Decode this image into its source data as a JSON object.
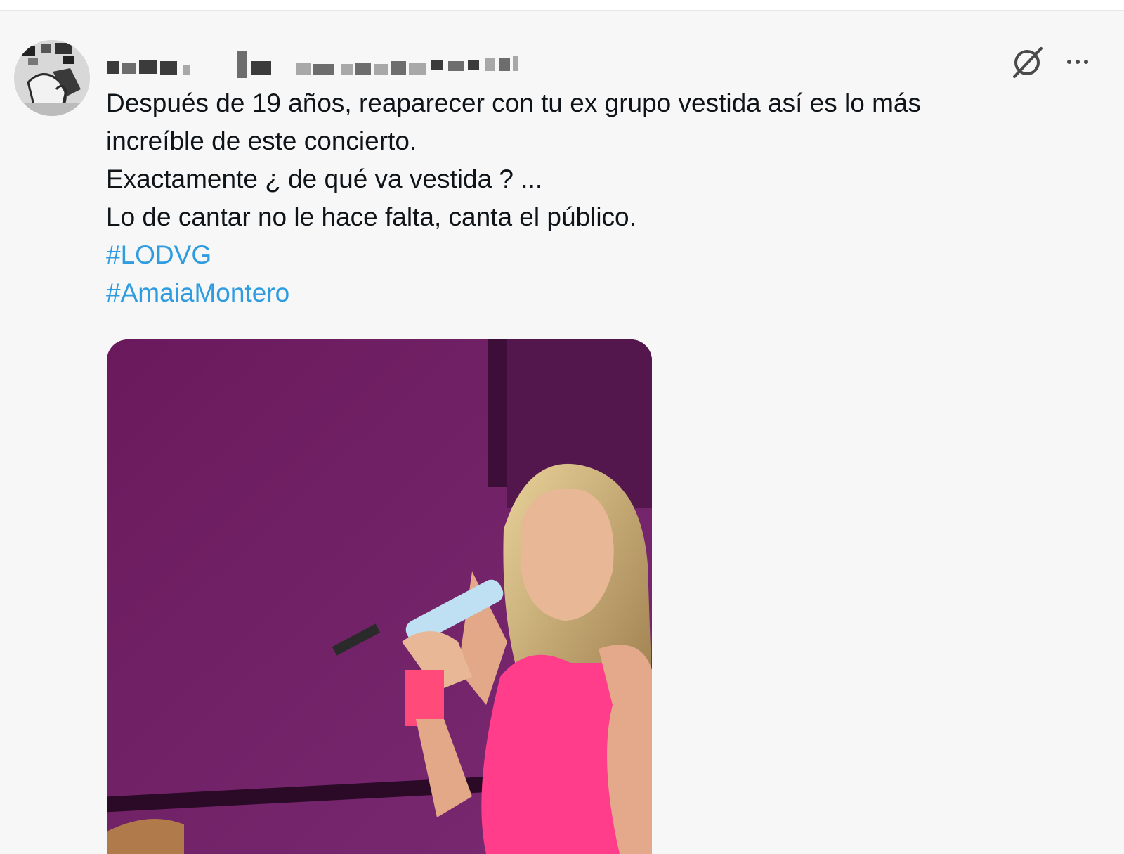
{
  "tweet": {
    "author_name": "",
    "lines": [
      "Después de 19 años, reaparecer con tu ex grupo vestida así es lo más",
      "increíble de este concierto.",
      "Exactamente ¿ de qué va vestida ? ...",
      "Lo de cantar no le hace falta, canta el público."
    ],
    "hashtags": [
      "#LODVG",
      "#AmaiaMontero"
    ]
  },
  "icons": {
    "avatar": "avatar",
    "grok": "grok-icon",
    "more": "more-icon"
  },
  "colors": {
    "background": "#f7f7f7",
    "text": "#0f1419",
    "hashtag": "#2f9ce0",
    "stage_magenta": "#6f1f62",
    "dress_pink": "#ff3d8b"
  }
}
